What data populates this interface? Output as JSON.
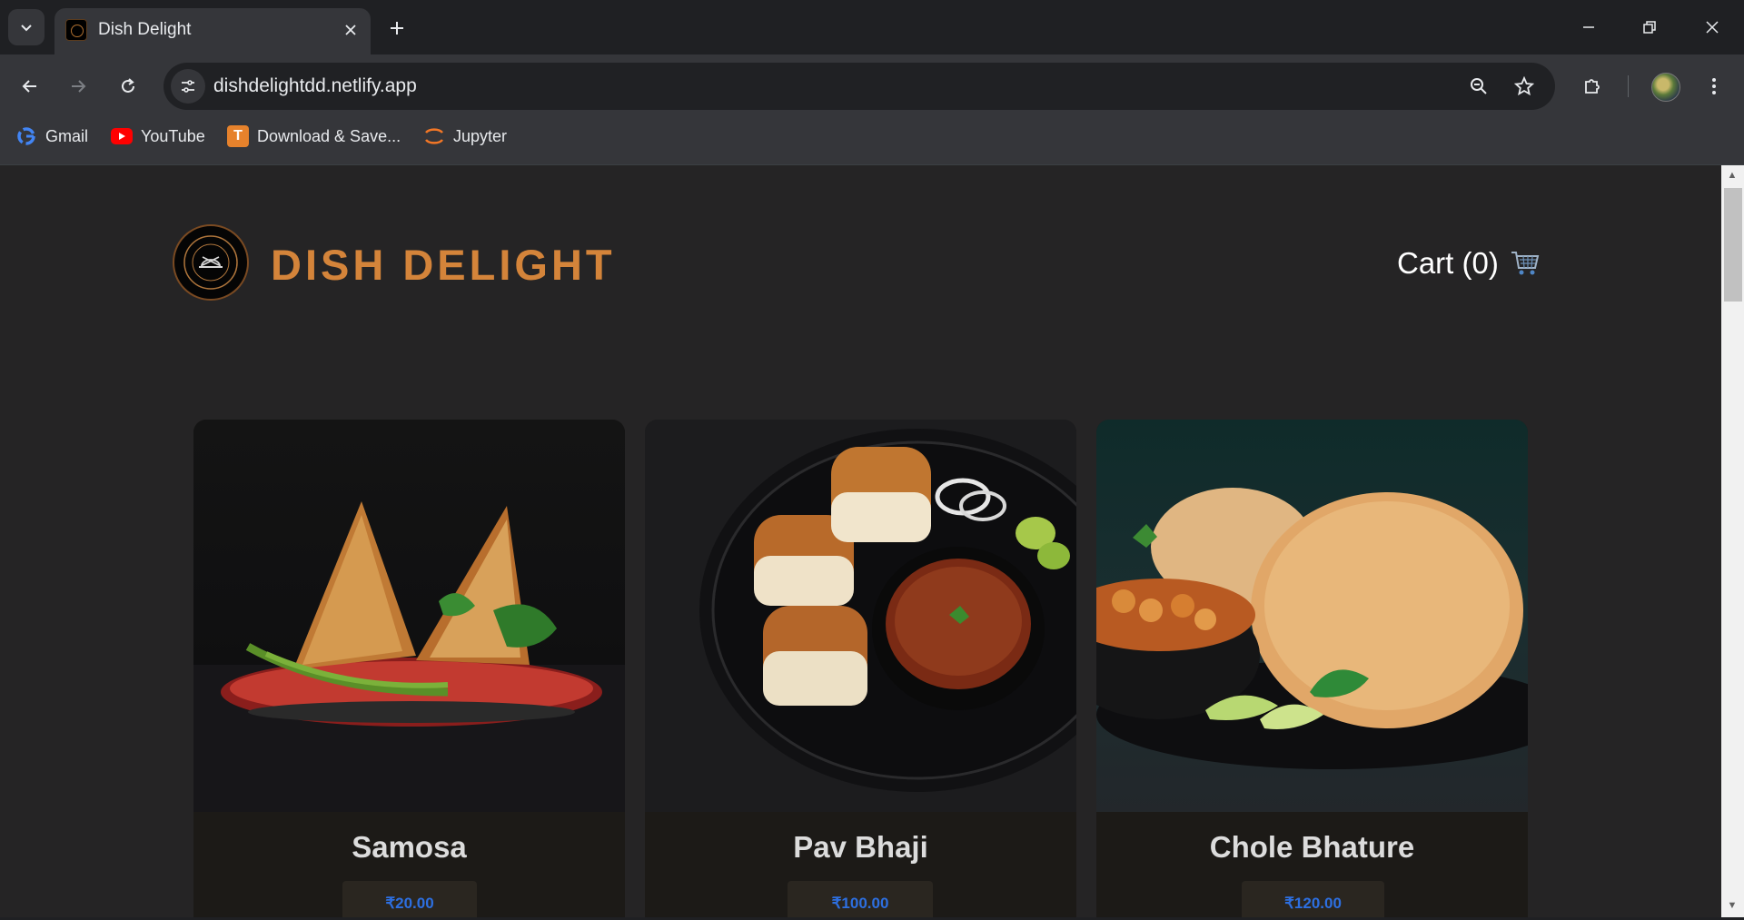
{
  "browser": {
    "tab_title": "Dish Delight",
    "url": "dishdelightdd.netlify.app",
    "bookmarks": [
      {
        "label": "Gmail",
        "icon": "google-icon"
      },
      {
        "label": "YouTube",
        "icon": "youtube-icon"
      },
      {
        "label": "Download & Save...",
        "icon": "download-save-icon"
      },
      {
        "label": "Jupyter",
        "icon": "jupyter-icon"
      }
    ]
  },
  "site": {
    "brand": "DISH DELIGHT",
    "cart_label": "Cart (0)",
    "brand_color": "#d4843a",
    "price_color": "#2d6fe0"
  },
  "products": [
    {
      "name": "Samosa",
      "price": "₹20.00"
    },
    {
      "name": "Pav Bhaji",
      "price": "₹100.00"
    },
    {
      "name": "Chole Bhature",
      "price": "₹120.00"
    }
  ]
}
